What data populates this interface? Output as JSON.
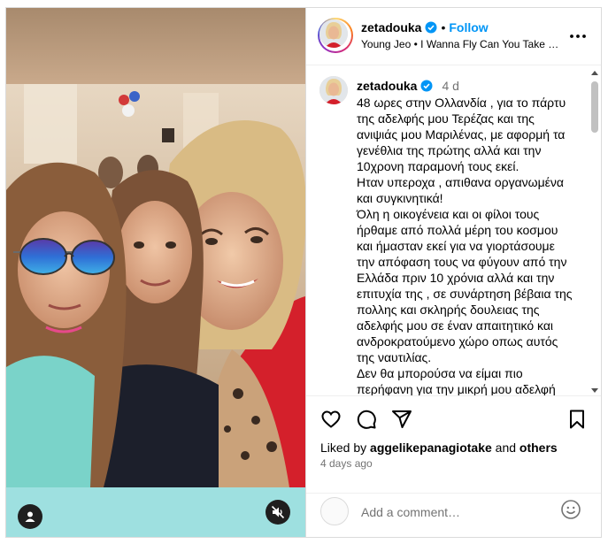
{
  "post": {
    "username": "zetadouka",
    "verified": true,
    "follow_label": "Follow",
    "audio_text": "Young Jeo • I Wanna Fly Can You Take Me Higher",
    "caption_username": "zetadouka",
    "caption_time": "4 d",
    "caption_text": "48 ωρες στην Ολλανδία , για το πάρτυ της αδελφής μου Τερέζας και της ανιψιάς μου Μαριλένας, με αφορμή τα γενέθλια της πρώτης αλλά και την 10χρονη παραμονή τους εκεί.\nΗταν υπεροχα , απιθανα οργανωμένα και συγκινητικά!\nΌλη η οικογένεια και οι φίλοι τους ήρθαμε από πολλά μέρη του κοσμου και ήμασταν εκεί για να γιορτάσουμε την απόφαση τους να φύγουν από την Ελλάδα πριν 10 χρόνια αλλά και την επιτυχία της , σε συνάρτηση βέβαια της πολλης και σκληρής δουλειας της αδελφής μου σε έναν απαιτητικό και ανδροκρατούμενο χώρο οπως αυτός της ναυτιλίας.\nΔεν θα μπορούσα να είμαι πιο περήφανη για την μικρή μου αδελφή"
  },
  "likes": {
    "prefix": "Liked by",
    "user": "aggelikepanagiotake",
    "and": "and",
    "others": "others"
  },
  "posted_ago": "4 days ago",
  "comment": {
    "placeholder": "Add a comment…"
  },
  "icons": {
    "more": "more-options-icon",
    "verified": "verified-badge-icon",
    "like": "heart-icon",
    "comment": "comment-icon",
    "share": "share-icon",
    "save": "bookmark-icon",
    "tags": "user-tag-icon",
    "mute": "muted-speaker-icon",
    "emoji": "emoji-icon"
  },
  "colors": {
    "accent": "#0095f6",
    "verified": "#0095f6",
    "muted_text": "#737373",
    "border": "#dbdbdb"
  }
}
